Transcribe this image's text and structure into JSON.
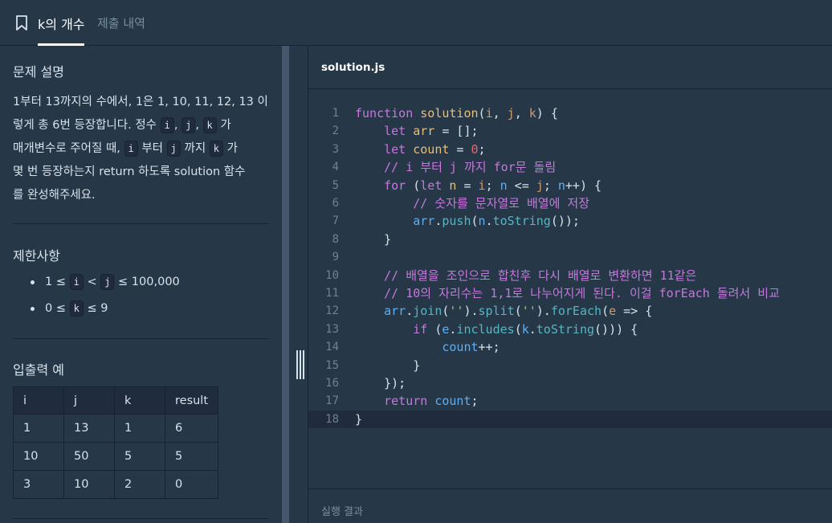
{
  "tabs": {
    "active_label": "k의 개수",
    "secondary_label": "제출 내역"
  },
  "problem": {
    "title": "문제 설명",
    "desc_line1": "1부터 13까지의 수에서, 1은 1, 10, 11, 12, 13 이",
    "desc_line2_a": "렇게 총 6번 등장합니다. 정수",
    "desc_sep1": ",",
    "desc_sep2": ",",
    "desc_line2_b": "가",
    "desc_line3_a": "매개변수로 주어질 때,",
    "desc_line3_b": "부터",
    "desc_line3_c": "까지",
    "desc_line3_d": "가",
    "desc_line4": "몇 번 등장하는지 return 하도록 solution 함수",
    "desc_line5": "를 완성해주세요.",
    "code_i": "i",
    "code_j": "j",
    "code_k": "k"
  },
  "limits": {
    "title": "제한사항",
    "item1_a": "1 ≤",
    "item1_b": "<",
    "item1_c": "≤ 100,000",
    "item2_a": "0 ≤",
    "item2_b": "≤ 9"
  },
  "io": {
    "title": "입출력 예",
    "headers": [
      "i",
      "j",
      "k",
      "result"
    ],
    "rows": [
      [
        "1",
        "13",
        "1",
        "6"
      ],
      [
        "10",
        "50",
        "5",
        "5"
      ],
      [
        "3",
        "10",
        "2",
        "0"
      ]
    ]
  },
  "editor": {
    "filename": "solution.js",
    "line_numbers": [
      "1",
      "2",
      "3",
      "4",
      "5",
      "6",
      "7",
      "8",
      "9",
      "10",
      "11",
      "12",
      "13",
      "14",
      "15",
      "16",
      "17",
      "18"
    ],
    "active_line": 18,
    "comment4": "// i 부터 j 까지 for문 돌림",
    "comment6": "// 숫자를 문자열로 배열에 저장",
    "comment10": "// 배열을 조인으로 합친후 다시 배열로 변환하면 11같은",
    "comment11": "// 10의 자리수는 1,1로 나누어지게 된다. 이걸 forEach 돌려서 비교"
  },
  "result": {
    "label": "실행 결과"
  },
  "colors": {
    "background": "#263747",
    "panel_dark": "#202b3d",
    "border": "#172334",
    "splitter": "#44576c"
  }
}
